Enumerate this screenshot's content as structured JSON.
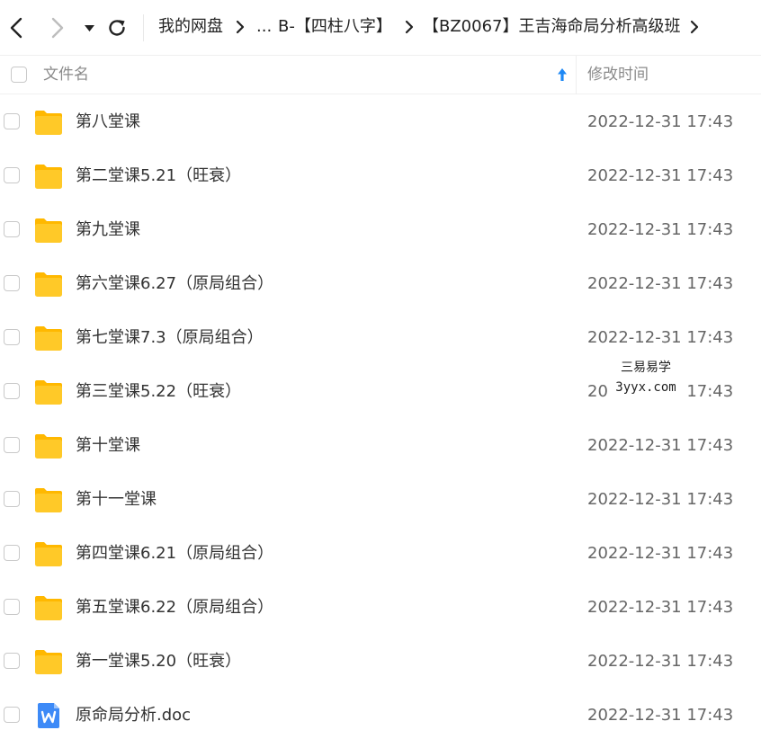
{
  "navigation": {
    "back_icon": "chevron-left-icon",
    "forward_icon": "chevron-right-icon",
    "history_icon": "caret-down-icon",
    "refresh_icon": "refresh-icon",
    "breadcrumb": {
      "root": "我的网盘",
      "ellipsis": "...",
      "parent": "B-【四柱八字】",
      "current": "【BZ0067】王吉海命局分析高级班"
    }
  },
  "header": {
    "name_column": "文件名",
    "time_column": "修改时间",
    "sort_icon": "sort-ascending-arrow-icon",
    "sort_color": "#1e88f5"
  },
  "files": [
    {
      "name": "第八堂课",
      "type": "folder",
      "modified": "2022-12-31 17:43"
    },
    {
      "name": "第二堂课5.21（旺衰）",
      "type": "folder",
      "modified": "2022-12-31 17:43"
    },
    {
      "name": "第九堂课",
      "type": "folder",
      "modified": "2022-12-31 17:43"
    },
    {
      "name": "第六堂课6.27（原局组合）",
      "type": "folder",
      "modified": "2022-12-31 17:43"
    },
    {
      "name": "第七堂课7.3（原局组合）",
      "type": "folder",
      "modified": "2022-12-31 17:43"
    },
    {
      "name": "第三堂课5.22（旺衰）",
      "type": "folder",
      "modified": "2022-12-31 17:43"
    },
    {
      "name": "第十堂课",
      "type": "folder",
      "modified": "2022-12-31 17:43"
    },
    {
      "name": "第十一堂课",
      "type": "folder",
      "modified": "2022-12-31 17:43"
    },
    {
      "name": "第四堂课6.21（原局组合）",
      "type": "folder",
      "modified": "2022-12-31 17:43"
    },
    {
      "name": "第五堂课6.22（原局组合）",
      "type": "folder",
      "modified": "2022-12-31 17:43"
    },
    {
      "name": "第一堂课5.20（旺衰）",
      "type": "folder",
      "modified": "2022-12-31 17:43"
    },
    {
      "name": "原命局分析.doc",
      "type": "word-doc",
      "modified": "2022-12-31 17:43"
    }
  ],
  "icons": {
    "folder": "folder-icon",
    "word_doc": "word-document-icon",
    "folder_color": "#ffc928",
    "folder_tab_color": "#ffb800",
    "doc_color": "#3d8af7"
  },
  "watermark": {
    "line1": "三易易学",
    "line2": "3yyx.com"
  }
}
